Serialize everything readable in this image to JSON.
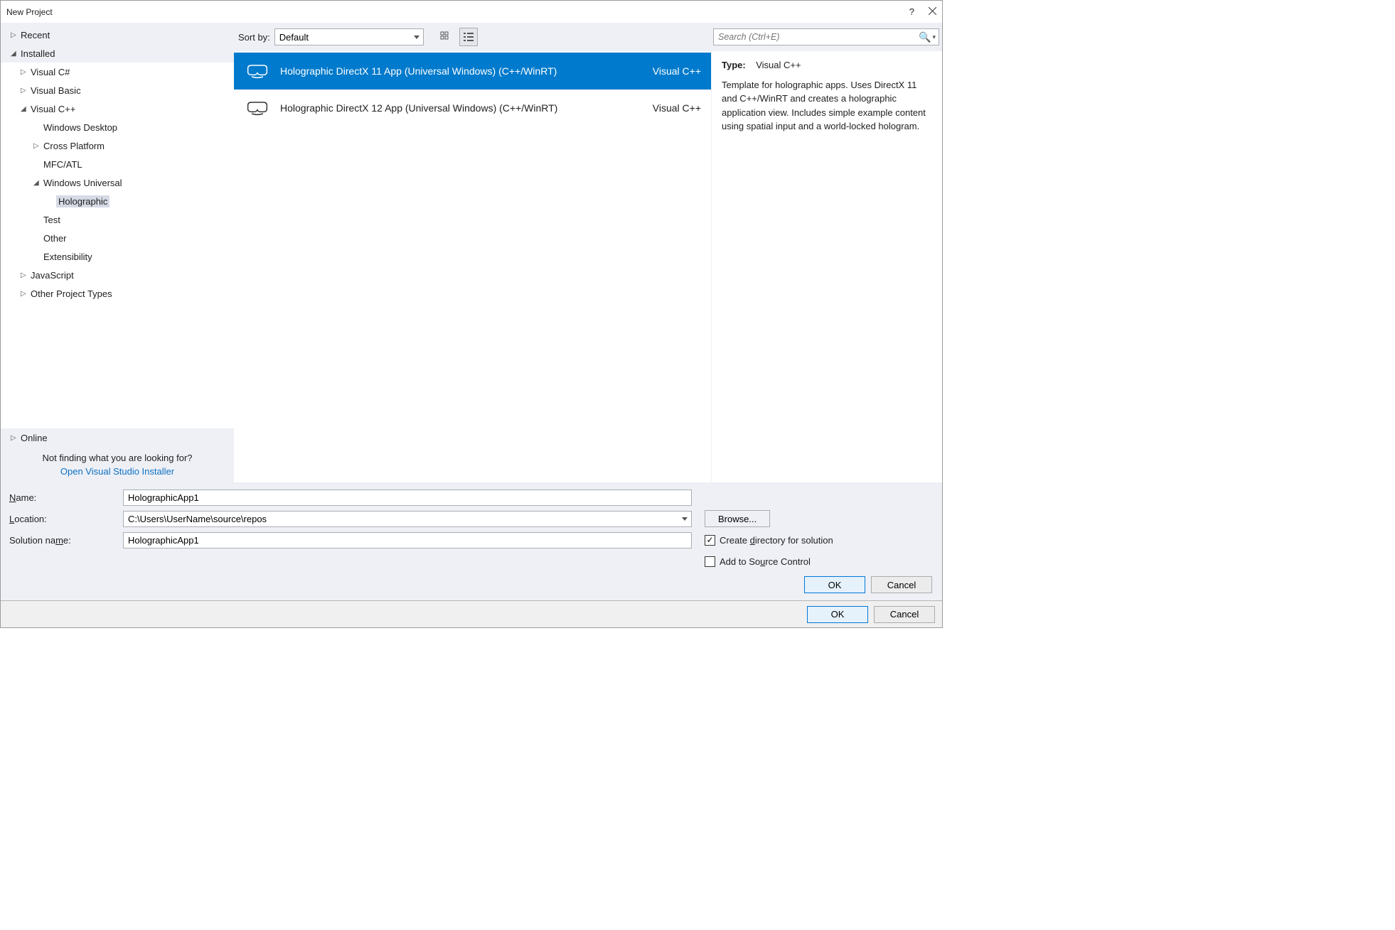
{
  "window": {
    "title": "New Project"
  },
  "tree": {
    "recent": "Recent",
    "installed": "Installed",
    "items": [
      {
        "label": "Visual C#",
        "glyph": "▷",
        "level": 1
      },
      {
        "label": "Visual Basic",
        "glyph": "▷",
        "level": 1
      },
      {
        "label": "Visual C++",
        "glyph": "◢",
        "level": 1
      },
      {
        "label": "Windows Desktop",
        "glyph": "",
        "level": 2
      },
      {
        "label": "Cross Platform",
        "glyph": "▷",
        "level": 2
      },
      {
        "label": "MFC/ATL",
        "glyph": "",
        "level": 2
      },
      {
        "label": "Windows Universal",
        "glyph": "◢",
        "level": 2
      },
      {
        "label": "Holographic",
        "glyph": "",
        "level": 3,
        "selected": true
      },
      {
        "label": "Test",
        "glyph": "",
        "level": 2
      },
      {
        "label": "Other",
        "glyph": "",
        "level": 2
      },
      {
        "label": "Extensibility",
        "glyph": "",
        "level": 2
      },
      {
        "label": "JavaScript",
        "glyph": "▷",
        "level": 1
      },
      {
        "label": "Other Project Types",
        "glyph": "▷",
        "level": 1
      }
    ],
    "online": "Online",
    "not_finding": "Not finding what you are looking for?",
    "installer_link": "Open Visual Studio Installer"
  },
  "toolbar": {
    "sort_label": "Sort by:",
    "sort_value": "Default"
  },
  "search": {
    "placeholder": "Search (Ctrl+E)"
  },
  "templates": [
    {
      "name": "Holographic DirectX 11 App (Universal Windows) (C++/WinRT)",
      "lang": "Visual C++",
      "selected": true
    },
    {
      "name": "Holographic DirectX 12 App (Universal Windows) (C++/WinRT)",
      "lang": "Visual C++",
      "selected": false
    }
  ],
  "info": {
    "type_label": "Type:",
    "type_value": "Visual C++",
    "description": "Template for holographic apps. Uses DirectX 11 and C++/WinRT and creates a holographic application view. Includes simple example content using spatial input and a world-locked hologram."
  },
  "form": {
    "name_label_pre": "N",
    "name_label_ul": "a",
    "name_label_post": "me:",
    "name_value": "HolographicApp1",
    "location_label_ul": "L",
    "location_label_post": "ocation:",
    "location_value": "C:\\Users\\UserName\\source\\repos",
    "solution_label_pre": "Solution na",
    "solution_label_ul": "m",
    "solution_label_post": "e:",
    "solution_value": "HolographicApp1",
    "browse_ul": "B",
    "browse_post": "rowse...",
    "create_dir_pre": "Create ",
    "create_dir_ul": "d",
    "create_dir_post": "irectory for solution",
    "source_ctrl_pre": "Add to So",
    "source_ctrl_ul": "u",
    "source_ctrl_post": "rce Control",
    "ok": "OK",
    "cancel": "Cancel"
  },
  "outer": {
    "ok": "OK",
    "cancel": "Cancel"
  }
}
